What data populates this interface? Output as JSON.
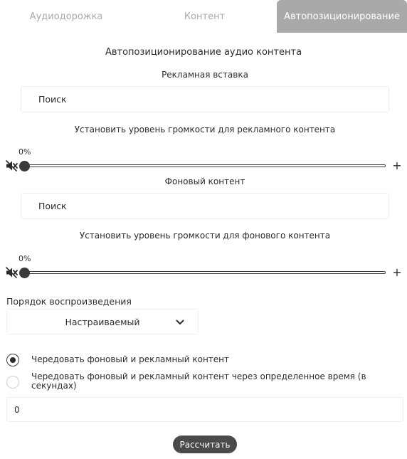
{
  "tabs": [
    {
      "label": "Аудиодорожка",
      "active": false
    },
    {
      "label": "Контент",
      "active": false
    },
    {
      "label": "Автопозиционирование",
      "active": true
    }
  ],
  "section_title": "Автопозиционирование аудио контента",
  "ad": {
    "title": "Рекламная вставка",
    "search_value": "Поиск",
    "volume_label": "Установить уровень громкости для рекламного контента",
    "volume_percent": "0%",
    "volume_value": 0
  },
  "background": {
    "title": "Фоновый контент",
    "search_value": "Поиск",
    "volume_label": "Установить уровень громкости для фонового контента",
    "volume_percent": "0%",
    "volume_value": 0
  },
  "playback": {
    "label": "Порядок воспроизведения",
    "selected": "Настраиваемый"
  },
  "options": [
    {
      "label": "Чередовать фоновый и рекламный контент",
      "checked": true
    },
    {
      "label": "Чередовать фоновый и рекламный контент через определенное время (в секундах)",
      "checked": false
    }
  ],
  "interval_value": "0",
  "calculate_label": "Рассчитать",
  "colors": {
    "tab_active_bg": "#a9a9a9",
    "button_bg": "#4a4a4a",
    "slider": "#3a3a3a"
  },
  "icons": [
    "mute-icon",
    "plus-icon",
    "chevron-down-icon"
  ]
}
